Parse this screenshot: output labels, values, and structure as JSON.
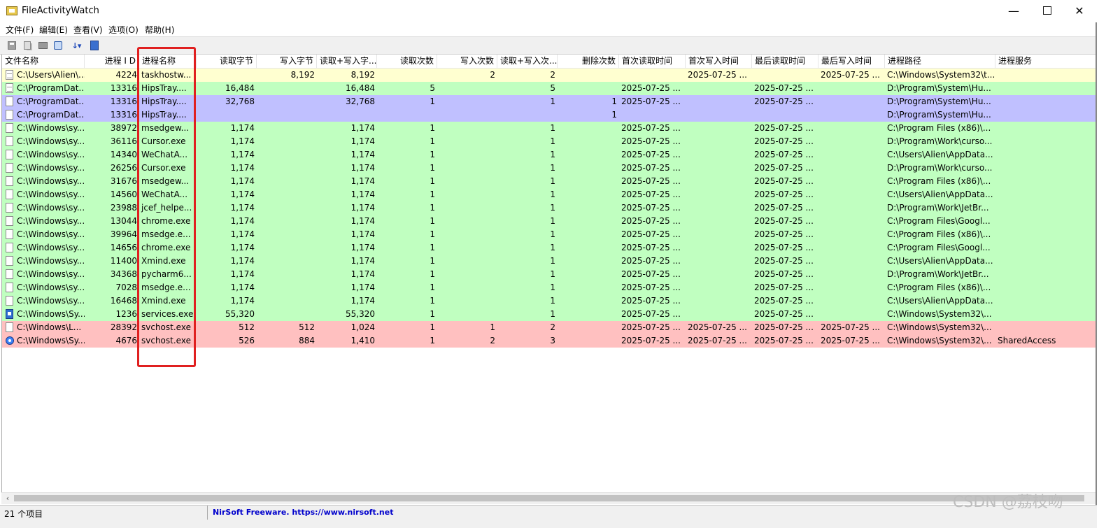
{
  "window": {
    "title": "FileActivityWatch",
    "controls": {
      "minimize": "—",
      "close": "✕"
    }
  },
  "menu": [
    "文件(F)",
    "编辑(E)",
    "查看(V)",
    "选项(O)",
    "帮助(H)"
  ],
  "toolbar": [
    "save-icon",
    "copy-icon",
    "properties-icon",
    "find-icon",
    "sort-icon",
    "exit-icon"
  ],
  "colors": {
    "yellow": "#ffffd0",
    "green": "#c0ffc0",
    "blue": "#c0c0ff",
    "red": "#ffc0c0",
    "highlight": "#e02020",
    "link": "#0000cc"
  },
  "columns": [
    "文件名称",
    "进程 I D",
    "进程名称",
    "读取字节",
    "写入字节",
    "读取+写入字...",
    "读取次数",
    "写入次数",
    "读取+写入次...",
    "删除次数",
    "首次读取时间",
    "首次写入时间",
    "最后读取时间",
    "最后写入时间",
    "进程路径",
    "进程服务"
  ],
  "rows": [
    {
      "color": "yellow",
      "icon": "doc",
      "c": [
        "C:\\Users\\Alien\\...",
        "4224",
        "taskhostw...",
        "",
        "8,192",
        "8,192",
        "",
        "2",
        "2",
        "",
        "",
        "2025-07-25 ...",
        "",
        "2025-07-25 ...",
        "C:\\Windows\\System32\\t...",
        ""
      ]
    },
    {
      "color": "green",
      "icon": "doc",
      "c": [
        "C:\\ProgramDat...",
        "13316",
        "HipsTray....",
        "16,484",
        "",
        "16,484",
        "5",
        "",
        "5",
        "",
        "2025-07-25 ...",
        "",
        "2025-07-25 ...",
        "",
        "D:\\Program\\System\\Hu...",
        ""
      ]
    },
    {
      "color": "blue",
      "icon": "blank",
      "c": [
        "C:\\ProgramDat...",
        "13316",
        "HipsTray....",
        "32,768",
        "",
        "32,768",
        "1",
        "",
        "1",
        "1",
        "2025-07-25 ...",
        "",
        "2025-07-25 ...",
        "",
        "D:\\Program\\System\\Hu...",
        ""
      ]
    },
    {
      "color": "blue",
      "icon": "blank",
      "c": [
        "C:\\ProgramDat...",
        "13316",
        "HipsTray....",
        "",
        "",
        "",
        "",
        "",
        "",
        "1",
        "",
        "",
        "",
        "",
        "D:\\Program\\System\\Hu...",
        ""
      ]
    },
    {
      "color": "green",
      "icon": "blank",
      "c": [
        "C:\\Windows\\sy...",
        "38972",
        "msedgew...",
        "1,174",
        "",
        "1,174",
        "1",
        "",
        "1",
        "",
        "2025-07-25 ...",
        "",
        "2025-07-25 ...",
        "",
        "C:\\Program Files (x86)\\...",
        ""
      ]
    },
    {
      "color": "green",
      "icon": "blank",
      "c": [
        "C:\\Windows\\sy...",
        "36116",
        "Cursor.exe",
        "1,174",
        "",
        "1,174",
        "1",
        "",
        "1",
        "",
        "2025-07-25 ...",
        "",
        "2025-07-25 ...",
        "",
        "D:\\Program\\Work\\curso...",
        ""
      ]
    },
    {
      "color": "green",
      "icon": "blank",
      "c": [
        "C:\\Windows\\sy...",
        "14340",
        "WeChatA...",
        "1,174",
        "",
        "1,174",
        "1",
        "",
        "1",
        "",
        "2025-07-25 ...",
        "",
        "2025-07-25 ...",
        "",
        "C:\\Users\\Alien\\AppData...",
        ""
      ]
    },
    {
      "color": "green",
      "icon": "blank",
      "c": [
        "C:\\Windows\\sy...",
        "26256",
        "Cursor.exe",
        "1,174",
        "",
        "1,174",
        "1",
        "",
        "1",
        "",
        "2025-07-25 ...",
        "",
        "2025-07-25 ...",
        "",
        "D:\\Program\\Work\\curso...",
        ""
      ]
    },
    {
      "color": "green",
      "icon": "blank",
      "c": [
        "C:\\Windows\\sy...",
        "31676",
        "msedgew...",
        "1,174",
        "",
        "1,174",
        "1",
        "",
        "1",
        "",
        "2025-07-25 ...",
        "",
        "2025-07-25 ...",
        "",
        "C:\\Program Files (x86)\\...",
        ""
      ]
    },
    {
      "color": "green",
      "icon": "blank",
      "c": [
        "C:\\Windows\\sy...",
        "14560",
        "WeChatA...",
        "1,174",
        "",
        "1,174",
        "1",
        "",
        "1",
        "",
        "2025-07-25 ...",
        "",
        "2025-07-25 ...",
        "",
        "C:\\Users\\Alien\\AppData...",
        ""
      ]
    },
    {
      "color": "green",
      "icon": "blank",
      "c": [
        "C:\\Windows\\sy...",
        "23988",
        "jcef_helpe...",
        "1,174",
        "",
        "1,174",
        "1",
        "",
        "1",
        "",
        "2025-07-25 ...",
        "",
        "2025-07-25 ...",
        "",
        "D:\\Program\\Work\\JetBr...",
        ""
      ]
    },
    {
      "color": "green",
      "icon": "blank",
      "c": [
        "C:\\Windows\\sy...",
        "13044",
        "chrome.exe",
        "1,174",
        "",
        "1,174",
        "1",
        "",
        "1",
        "",
        "2025-07-25 ...",
        "",
        "2025-07-25 ...",
        "",
        "C:\\Program Files\\Googl...",
        ""
      ]
    },
    {
      "color": "green",
      "icon": "blank",
      "c": [
        "C:\\Windows\\sy...",
        "39964",
        "msedge.e...",
        "1,174",
        "",
        "1,174",
        "1",
        "",
        "1",
        "",
        "2025-07-25 ...",
        "",
        "2025-07-25 ...",
        "",
        "C:\\Program Files (x86)\\...",
        ""
      ]
    },
    {
      "color": "green",
      "icon": "blank",
      "c": [
        "C:\\Windows\\sy...",
        "14656",
        "chrome.exe",
        "1,174",
        "",
        "1,174",
        "1",
        "",
        "1",
        "",
        "2025-07-25 ...",
        "",
        "2025-07-25 ...",
        "",
        "C:\\Program Files\\Googl...",
        ""
      ]
    },
    {
      "color": "green",
      "icon": "blank",
      "c": [
        "C:\\Windows\\sy...",
        "11400",
        "Xmind.exe",
        "1,174",
        "",
        "1,174",
        "1",
        "",
        "1",
        "",
        "2025-07-25 ...",
        "",
        "2025-07-25 ...",
        "",
        "C:\\Users\\Alien\\AppData...",
        ""
      ]
    },
    {
      "color": "green",
      "icon": "blank",
      "c": [
        "C:\\Windows\\sy...",
        "34368",
        "pycharm6...",
        "1,174",
        "",
        "1,174",
        "1",
        "",
        "1",
        "",
        "2025-07-25 ...",
        "",
        "2025-07-25 ...",
        "",
        "D:\\Program\\Work\\JetBr...",
        ""
      ]
    },
    {
      "color": "green",
      "icon": "blank",
      "c": [
        "C:\\Windows\\sy...",
        "7028",
        "msedge.e...",
        "1,174",
        "",
        "1,174",
        "1",
        "",
        "1",
        "",
        "2025-07-25 ...",
        "",
        "2025-07-25 ...",
        "",
        "C:\\Program Files (x86)\\...",
        ""
      ]
    },
    {
      "color": "green",
      "icon": "blank",
      "c": [
        "C:\\Windows\\sy...",
        "16468",
        "Xmind.exe",
        "1,174",
        "",
        "1,174",
        "1",
        "",
        "1",
        "",
        "2025-07-25 ...",
        "",
        "2025-07-25 ...",
        "",
        "C:\\Users\\Alien\\AppData...",
        ""
      ]
    },
    {
      "color": "green",
      "icon": "svc",
      "c": [
        "C:\\Windows\\Sy...",
        "1236",
        "services.exe",
        "55,320",
        "",
        "55,320",
        "1",
        "",
        "1",
        "",
        "2025-07-25 ...",
        "",
        "2025-07-25 ...",
        "",
        "C:\\Windows\\System32\\...",
        ""
      ]
    },
    {
      "color": "red",
      "icon": "blank",
      "c": [
        "C:\\Windows\\L...",
        "28392",
        "svchost.exe",
        "512",
        "512",
        "1,024",
        "1",
        "1",
        "2",
        "",
        "2025-07-25 ...",
        "2025-07-25 ...",
        "2025-07-25 ...",
        "2025-07-25 ...",
        "C:\\Windows\\System32\\...",
        ""
      ]
    },
    {
      "color": "red",
      "icon": "gear",
      "c": [
        "C:\\Windows\\Sy...",
        "4676",
        "svchost.exe",
        "526",
        "884",
        "1,410",
        "1",
        "2",
        "3",
        "",
        "2025-07-25 ...",
        "2025-07-25 ...",
        "2025-07-25 ...",
        "2025-07-25 ...",
        "C:\\Windows\\System32\\...",
        "SharedAccess"
      ]
    }
  ],
  "status": {
    "count": "21 个项目",
    "link": "NirSoft Freeware. https://www.nirsoft.net"
  },
  "watermark": "CSDN @荔枝吻"
}
